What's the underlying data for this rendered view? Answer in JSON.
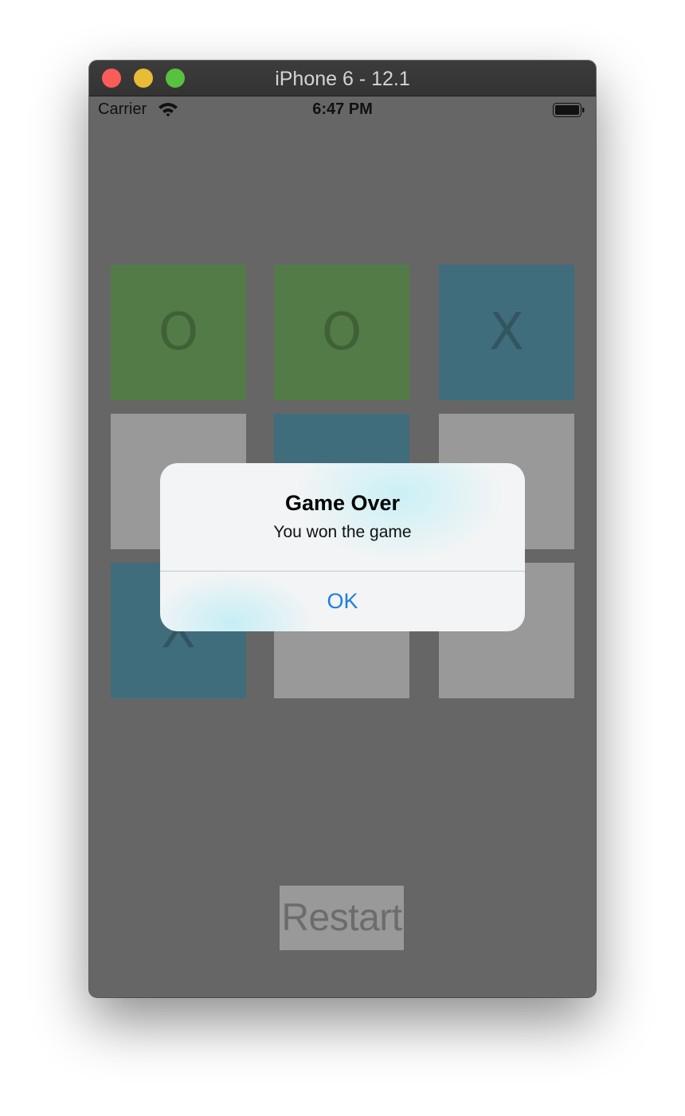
{
  "window": {
    "title": "iPhone 6 - 12.1"
  },
  "status_bar": {
    "carrier": "Carrier",
    "time": "6:47 PM",
    "wifi_icon": "wifi-icon",
    "battery_icon": "battery-icon"
  },
  "board": {
    "cells": [
      {
        "mark": "O",
        "color": "#527b47"
      },
      {
        "mark": "O",
        "color": "#527b47"
      },
      {
        "mark": "X",
        "color": "#406d7c"
      },
      {
        "mark": "",
        "color": "#999999"
      },
      {
        "mark": "",
        "color": "#406d7c"
      },
      {
        "mark": "",
        "color": "#999999"
      },
      {
        "mark": "X",
        "color": "#406d7c"
      },
      {
        "mark": "",
        "color": "#999999"
      },
      {
        "mark": "",
        "color": "#999999"
      }
    ]
  },
  "restart_label": "Restart",
  "alert": {
    "title": "Game Over",
    "message": "You won the game",
    "ok_label": "OK"
  },
  "colors": {
    "accent": "#1c7fdc",
    "background": "#666666",
    "o_cell": "#527b47",
    "x_cell": "#406d7c",
    "empty_cell": "#999999"
  }
}
